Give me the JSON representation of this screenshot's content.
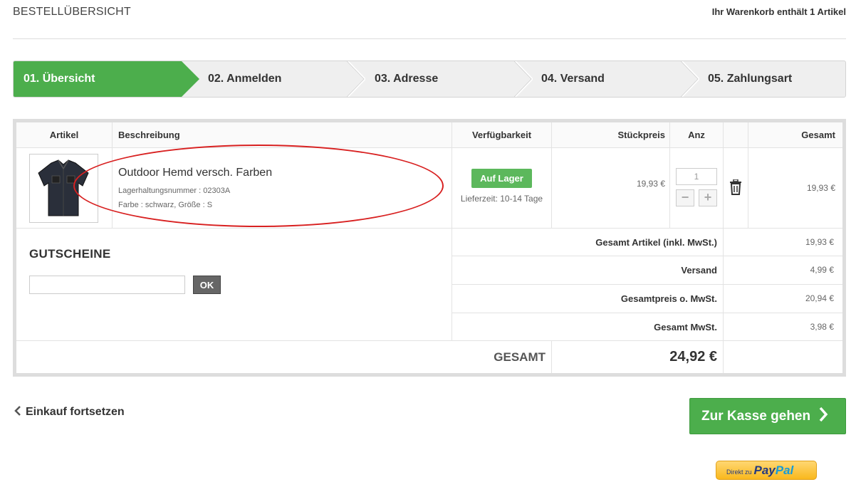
{
  "header": {
    "title": "BESTELLÜBERSICHT",
    "cart_info": "Ihr Warenkorb enthält 1 Artikel"
  },
  "steps": [
    {
      "label": "01. Übersicht",
      "active": true
    },
    {
      "label": "02. Anmelden",
      "active": false
    },
    {
      "label": "03. Adresse",
      "active": false
    },
    {
      "label": "04. Versand",
      "active": false
    },
    {
      "label": "05. Zahlungsart",
      "active": false
    }
  ],
  "table": {
    "headers": {
      "artikel": "Artikel",
      "beschreibung": "Beschreibung",
      "verfuegbarkeit": "Verfügbarkeit",
      "stueckpreis": "Stückpreis",
      "anz": "Anz",
      "gesamt": "Gesamt"
    },
    "item": {
      "name": "Outdoor Hemd versch. Farben",
      "sku": "Lagerhaltungsnummer : 02303A",
      "variant": "Farbe : schwarz, Größe : S",
      "availability": "Auf Lager",
      "delivery": "Lieferzeit: 10-14 Tage",
      "unit_price": "19,93 €",
      "quantity": "1",
      "total": "19,93 €"
    }
  },
  "voucher": {
    "title": "GUTSCHEINE",
    "input_value": "",
    "ok_label": "OK"
  },
  "summary": [
    {
      "label": "Gesamt Artikel (inkl. MwSt.)",
      "value": "19,93 €"
    },
    {
      "label": "Versand",
      "value": "4,99 €"
    },
    {
      "label": "Gesamtpreis o. MwSt.",
      "value": "20,94 €"
    },
    {
      "label": "Gesamt MwSt.",
      "value": "3,98 €"
    }
  ],
  "grand_total": {
    "label": "GESAMT",
    "value": "24,92 €"
  },
  "actions": {
    "continue_label": "Einkauf fortsetzen",
    "checkout_label": "Zur Kasse gehen",
    "paypal_prefix": "Direkt zu",
    "paypal_brand_1": "Pay",
    "paypal_brand_2": "Pal"
  },
  "colors": {
    "accent_green": "#4cae4c",
    "highlight_red": "#d82020"
  }
}
